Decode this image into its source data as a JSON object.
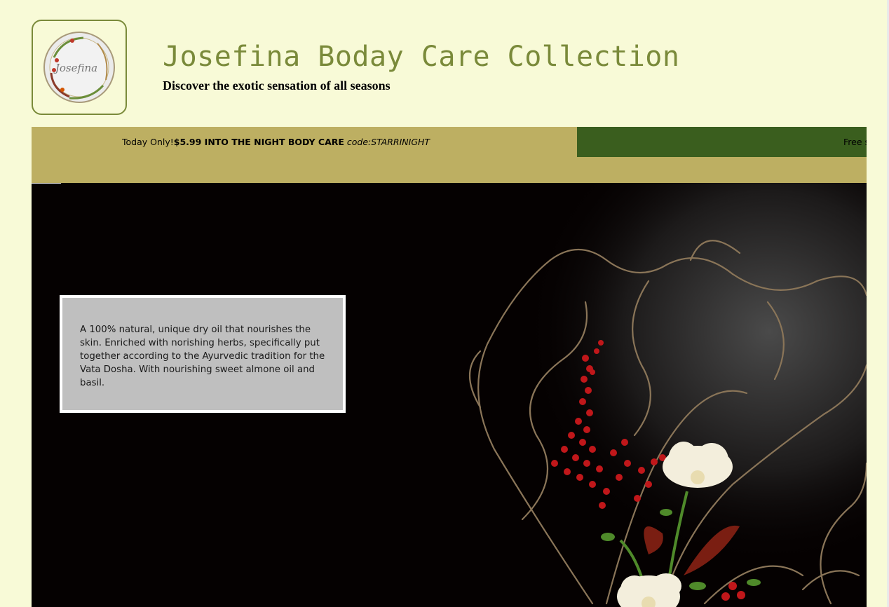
{
  "header": {
    "title": "Josefina Boday Care Collection",
    "subtitle": "Discover the exotic sensation of all seasons",
    "logo_text": "Josefina"
  },
  "promo": {
    "item1": {
      "prefix": "Today Only!",
      "deal": "$5.99 INTO THE NIGHT BODY CARE",
      "code": "code:STARRINIGHT"
    },
    "item2": {
      "text": "Free s"
    }
  },
  "hero": {
    "description": "A 100% natural, unique dry oil that nourishes the skin. Enriched with norishing herbs, specifically put together according to the Ayurvedic tradition for the Vata Dosha. With nourishing sweet almone oil and basil."
  },
  "colors": {
    "page_bg": "#f8fad7",
    "title_olive": "#7a8a3a",
    "promo_tan": "#bdaf62",
    "promo_green": "#3a5e1e",
    "hero_bg": "#050101",
    "desc_box": "#bfbfbf"
  }
}
